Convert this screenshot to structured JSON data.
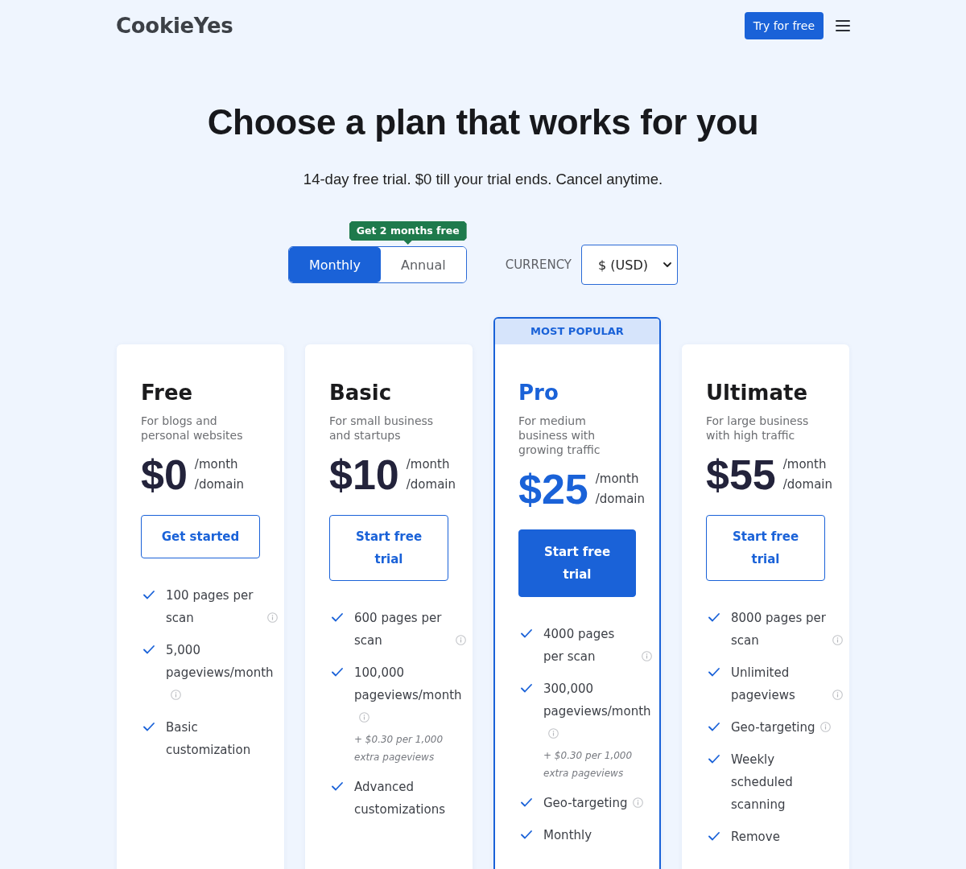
{
  "header": {
    "logo": "CookieYes",
    "cta": "Try for free"
  },
  "hero": {
    "title": "Choose a plan that works for you",
    "subtitle": "14-day free trial. $0 till your trial ends. Cancel anytime."
  },
  "billing": {
    "offer": "Get 2 months free",
    "options": [
      {
        "label": "Monthly",
        "selected": true
      },
      {
        "label": "Annual",
        "selected": false
      }
    ]
  },
  "currency": {
    "label": "CURRENCY",
    "value": "$ (USD)"
  },
  "plans": [
    {
      "name": "Free",
      "description": "For blogs and personal websites",
      "price": "$0",
      "period": [
        "/month",
        "/domain"
      ],
      "button": "Get started",
      "popular": false,
      "features": [
        {
          "text": "100 pages per scan",
          "info": true
        },
        {
          "text": "5,000 pageviews/month",
          "info": true
        },
        {
          "text": "Basic customization",
          "info": false
        }
      ]
    },
    {
      "name": "Basic",
      "description": "For small business and startups",
      "price": "$10",
      "period": [
        "/month",
        "/domain"
      ],
      "button": "Start free trial",
      "popular": false,
      "features": [
        {
          "text": "600 pages per scan",
          "info": true
        },
        {
          "text": "100,000 pageviews/month",
          "info": true,
          "note": "+ $0.30 per 1,000 extra pageviews"
        },
        {
          "text": "Advanced customizations",
          "info": false
        }
      ]
    },
    {
      "name": "Pro",
      "badge": "MOST POPULAR",
      "description": "For medium business with growing traffic",
      "price": "$25",
      "period": [
        "/month",
        "/domain"
      ],
      "button": "Start free trial",
      "popular": true,
      "features": [
        {
          "text": "4000 pages per scan",
          "info": true
        },
        {
          "text": "300,000 pageviews/month",
          "info": true,
          "note": "+ $0.30 per 1,000 extra pageviews"
        },
        {
          "text": "Geo-targeting",
          "info": true
        },
        {
          "text": "Monthly",
          "info": false
        }
      ]
    },
    {
      "name": "Ultimate",
      "description": "For large business with high traffic",
      "price": "$55",
      "period": [
        "/month",
        "/domain"
      ],
      "button": "Start free trial",
      "popular": false,
      "features": [
        {
          "text": "8000 pages per scan",
          "info": true
        },
        {
          "text": "Unlimited pageviews",
          "info": true
        },
        {
          "text": "Geo-targeting",
          "info": true
        },
        {
          "text": "Weekly scheduled scanning",
          "info": false
        },
        {
          "text": "Remove",
          "info": false
        }
      ]
    }
  ]
}
